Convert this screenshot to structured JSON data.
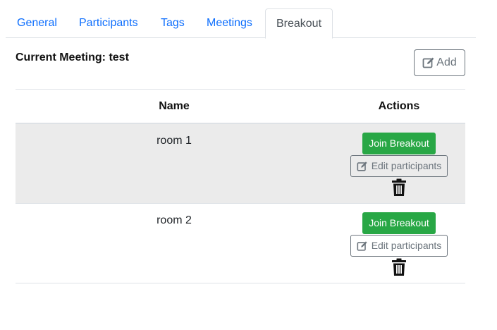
{
  "tabs": [
    {
      "label": "General",
      "active": false
    },
    {
      "label": "Participants",
      "active": false
    },
    {
      "label": "Tags",
      "active": false
    },
    {
      "label": "Meetings",
      "active": false
    },
    {
      "label": "Breakout",
      "active": true
    }
  ],
  "header": {
    "current_meeting": "Current Meeting: test",
    "add_label": "Add"
  },
  "table": {
    "columns": [
      "Name",
      "Actions"
    ],
    "rows": [
      {
        "name": "room 1",
        "join_label": "Join Breakout",
        "edit_label": "Edit participants"
      },
      {
        "name": "room 2",
        "join_label": "Join Breakout",
        "edit_label": "Edit participants"
      }
    ]
  },
  "icons": {
    "add": "edit-icon",
    "edit": "edit-icon",
    "delete": "trash-icon"
  },
  "colors": {
    "link": "#0d6efd",
    "success": "#28a745",
    "secondary": "#6c757d",
    "stripe": "#ebebeb"
  }
}
